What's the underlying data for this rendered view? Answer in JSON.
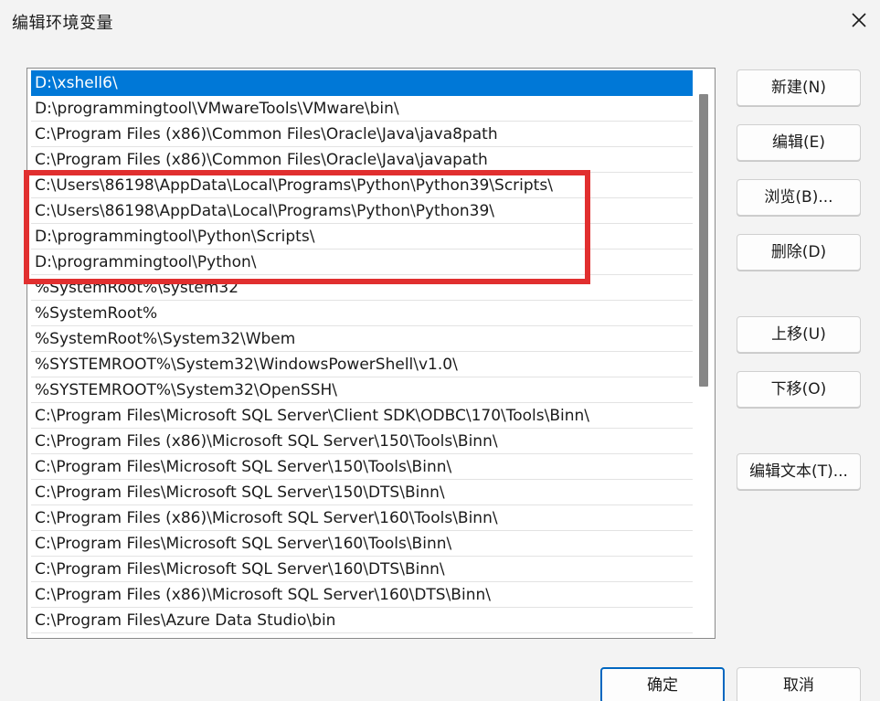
{
  "window": {
    "title": "编辑环境变量"
  },
  "path_list": {
    "selected_index": 0,
    "items": [
      "D:\\xshell6\\",
      "D:\\programmingtool\\VMwareTools\\VMware\\bin\\",
      "C:\\Program Files (x86)\\Common Files\\Oracle\\Java\\java8path",
      "C:\\Program Files (x86)\\Common Files\\Oracle\\Java\\javapath",
      "C:\\Users\\86198\\AppData\\Local\\Programs\\Python\\Python39\\Scripts\\",
      "C:\\Users\\86198\\AppData\\Local\\Programs\\Python\\Python39\\",
      "D:\\programmingtool\\Python\\Scripts\\",
      "D:\\programmingtool\\Python\\",
      "%SystemRoot%\\system32",
      "%SystemRoot%",
      "%SystemRoot%\\System32\\Wbem",
      "%SYSTEMROOT%\\System32\\WindowsPowerShell\\v1.0\\",
      "%SYSTEMROOT%\\System32\\OpenSSH\\",
      "C:\\Program Files\\Microsoft SQL Server\\Client SDK\\ODBC\\170\\Tools\\Binn\\",
      "C:\\Program Files (x86)\\Microsoft SQL Server\\150\\Tools\\Binn\\",
      "C:\\Program Files\\Microsoft SQL Server\\150\\Tools\\Binn\\",
      "C:\\Program Files\\Microsoft SQL Server\\150\\DTS\\Binn\\",
      "C:\\Program Files (x86)\\Microsoft SQL Server\\160\\Tools\\Binn\\",
      "C:\\Program Files\\Microsoft SQL Server\\160\\Tools\\Binn\\",
      "C:\\Program Files\\Microsoft SQL Server\\160\\DTS\\Binn\\",
      "C:\\Program Files (x86)\\Microsoft SQL Server\\160\\DTS\\Binn\\",
      "C:\\Program Files\\Azure Data Studio\\bin"
    ]
  },
  "buttons": {
    "new": "新建(N)",
    "edit": "编辑(E)",
    "browse": "浏览(B)...",
    "delete": "删除(D)",
    "move_up": "上移(U)",
    "move_down": "下移(O)",
    "edit_text": "编辑文本(T)...",
    "ok": "确定",
    "cancel": "取消"
  },
  "colors": {
    "selection": "#0078d7",
    "highlight_annotation": "#e12f2f",
    "primary_border": "#0067c0"
  },
  "icons": {
    "close": "close-icon"
  }
}
